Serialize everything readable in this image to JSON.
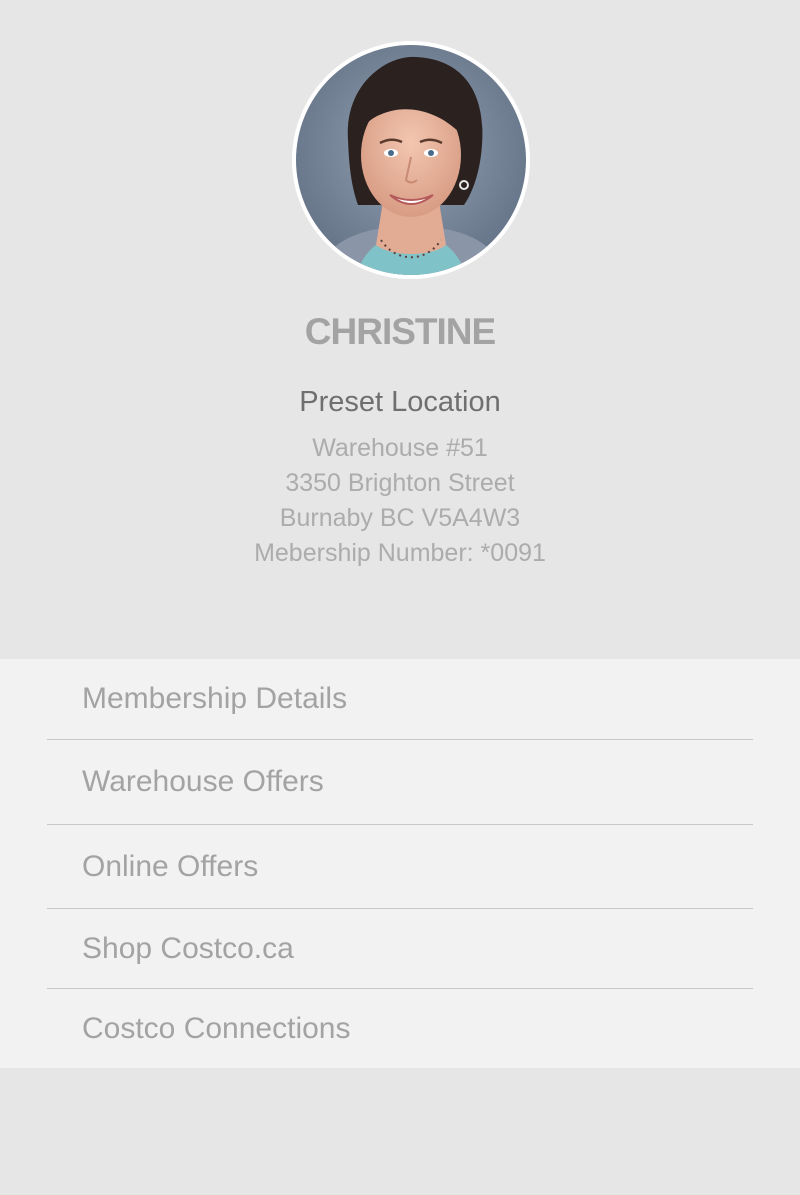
{
  "profile": {
    "name": "CHRISTINE",
    "preset_title": "Preset Location",
    "warehouse": "Warehouse #51",
    "street": "3350 Brighton Street",
    "city": "Burnaby BC V5A4W3",
    "membership": "Mebership Number: *0091"
  },
  "menu": {
    "items": [
      {
        "label": "Membership Details"
      },
      {
        "label": "Warehouse Offers"
      },
      {
        "label": "Online Offers"
      },
      {
        "label": "Shop Costco.ca"
      },
      {
        "label": "Costco Connections"
      }
    ]
  },
  "colors": {
    "background": "#e6e6e6",
    "menu_background": "#f2f2f3",
    "name_text": "#a3a3a3",
    "title_text": "#6f6f6f",
    "detail_text": "#acacac",
    "divider": "#c8c8c8"
  }
}
